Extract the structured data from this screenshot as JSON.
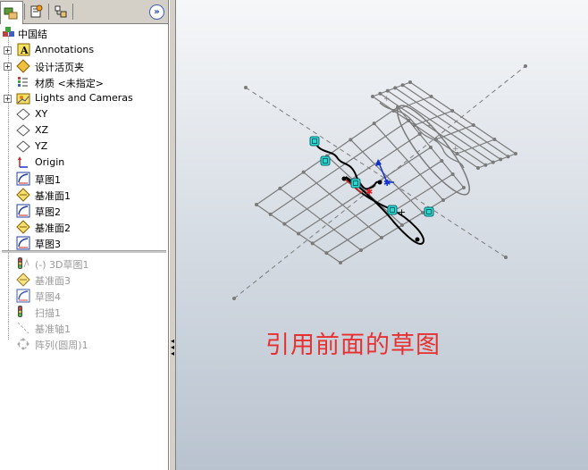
{
  "tabs": [
    {
      "name": "feature-manager",
      "icon": "feature-tree-icon",
      "active": true
    },
    {
      "name": "property-manager",
      "icon": "property-sheet-icon",
      "active": false
    },
    {
      "name": "configuration-manager",
      "icon": "configuration-icon",
      "active": false
    }
  ],
  "expand_glyph": "»",
  "tree": [
    {
      "label": "中国结",
      "icon": "part-icon",
      "expander": false,
      "grey": false
    },
    {
      "label": "Annotations",
      "icon": "annotations-icon",
      "expander": true,
      "grey": false
    },
    {
      "label": "设计活页夹",
      "icon": "design-binder-icon",
      "expander": true,
      "grey": false
    },
    {
      "label": "材质 <未指定>",
      "icon": "material-icon",
      "expander": false,
      "grey": false
    },
    {
      "label": "Lights and Cameras",
      "icon": "lights-cameras-icon",
      "expander": true,
      "grey": false
    },
    {
      "label": "XY",
      "icon": "plane-icon",
      "expander": false,
      "grey": false
    },
    {
      "label": "XZ",
      "icon": "plane-icon",
      "expander": false,
      "grey": false
    },
    {
      "label": "YZ",
      "icon": "plane-icon",
      "expander": false,
      "grey": false
    },
    {
      "label": "Origin",
      "icon": "origin-icon",
      "expander": false,
      "grey": false
    },
    {
      "label": "草图1",
      "icon": "sketch-icon",
      "expander": false,
      "grey": false
    },
    {
      "label": "基准面1",
      "icon": "datum-plane-icon",
      "expander": false,
      "grey": false
    },
    {
      "label": "草图2",
      "icon": "sketch-icon",
      "expander": false,
      "grey": false
    },
    {
      "label": "基准面2",
      "icon": "datum-plane-icon",
      "expander": false,
      "grey": false
    },
    {
      "label": "草图3",
      "icon": "sketch-icon",
      "expander": false,
      "grey": false
    },
    {
      "label": "(-) 3D草图1",
      "icon": "3d-sketch-icon",
      "expander": false,
      "grey": true
    },
    {
      "label": "基准面3",
      "icon": "datum-plane-icon",
      "expander": false,
      "grey": true
    },
    {
      "label": "草图4",
      "icon": "sketch-icon",
      "expander": false,
      "grey": true
    },
    {
      "label": "扫描1",
      "icon": "sweep-icon",
      "expander": false,
      "grey": true
    },
    {
      "label": "基准轴1",
      "icon": "axis-icon",
      "expander": false,
      "grey": true
    },
    {
      "label": "阵列(圆周)1",
      "icon": "circular-pattern-icon",
      "expander": false,
      "grey": true
    }
  ],
  "caption": "引用前面的草图",
  "colors": {
    "caption": "#e83030",
    "sketch_line": "#000000",
    "grid_line": "#7a7a7a",
    "handle": "#2fd6d0",
    "axis_blue": "#1030d0",
    "axis_red": "#e02020"
  }
}
